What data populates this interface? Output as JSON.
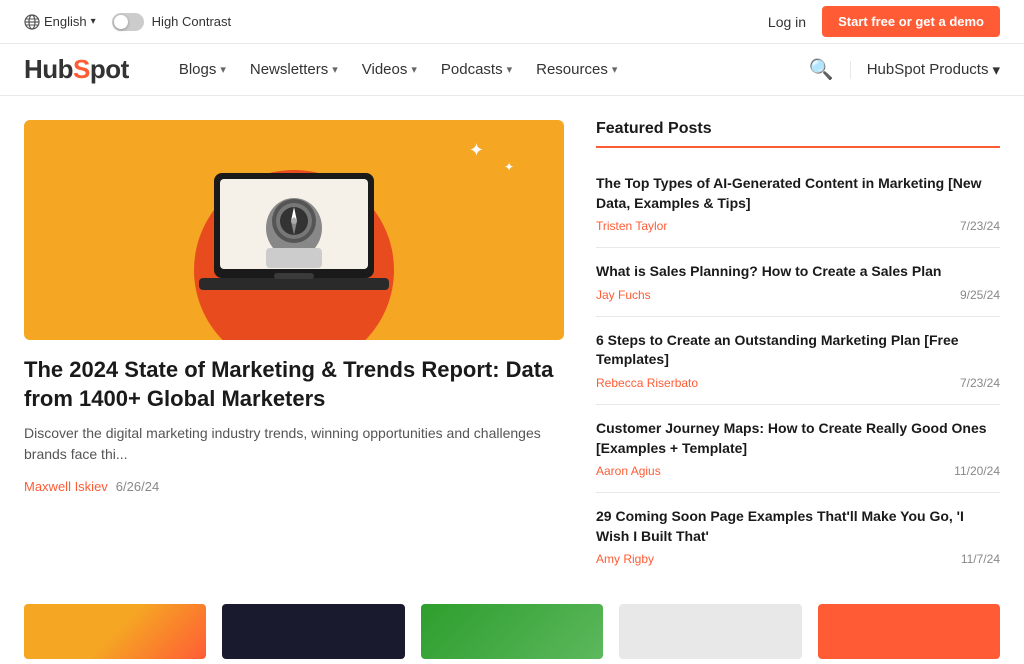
{
  "topbar": {
    "language": "English",
    "high_contrast": "High Contrast",
    "login": "Log in",
    "cta": "Start free or get a demo"
  },
  "nav": {
    "logo": "HubSpot",
    "links": [
      {
        "label": "Blogs",
        "has_dropdown": true
      },
      {
        "label": "Newsletters",
        "has_dropdown": true
      },
      {
        "label": "Videos",
        "has_dropdown": true
      },
      {
        "label": "Podcasts",
        "has_dropdown": true
      },
      {
        "label": "Resources",
        "has_dropdown": true
      }
    ],
    "products": "HubSpot Products"
  },
  "hero": {
    "title": "The 2024 State of Marketing & Trends Report: Data from 1400+ Global Marketers",
    "description": "Discover the digital marketing industry trends, winning opportunities and challenges brands face thi...",
    "author": "Maxwell Iskiev",
    "date": "6/26/24"
  },
  "featured": {
    "section_title": "Featured Posts",
    "posts": [
      {
        "title": "The Top Types of AI-Generated Content in Marketing [New Data, Examples & Tips]",
        "author": "Tristen Taylor",
        "date": "7/23/24"
      },
      {
        "title": "What is Sales Planning? How to Create a Sales Plan",
        "author": "Jay Fuchs",
        "date": "9/25/24"
      },
      {
        "title": "6 Steps to Create an Outstanding Marketing Plan [Free Templates]",
        "author": "Rebecca Riserbato",
        "date": "7/23/24"
      },
      {
        "title": "Customer Journey Maps: How to Create Really Good Ones [Examples + Template]",
        "author": "Aaron Agius",
        "date": "11/20/24"
      },
      {
        "title": "29 Coming Soon Page Examples That'll Make You Go, 'I Wish I Built That'",
        "author": "Amy Rigby",
        "date": "11/7/24"
      }
    ]
  }
}
